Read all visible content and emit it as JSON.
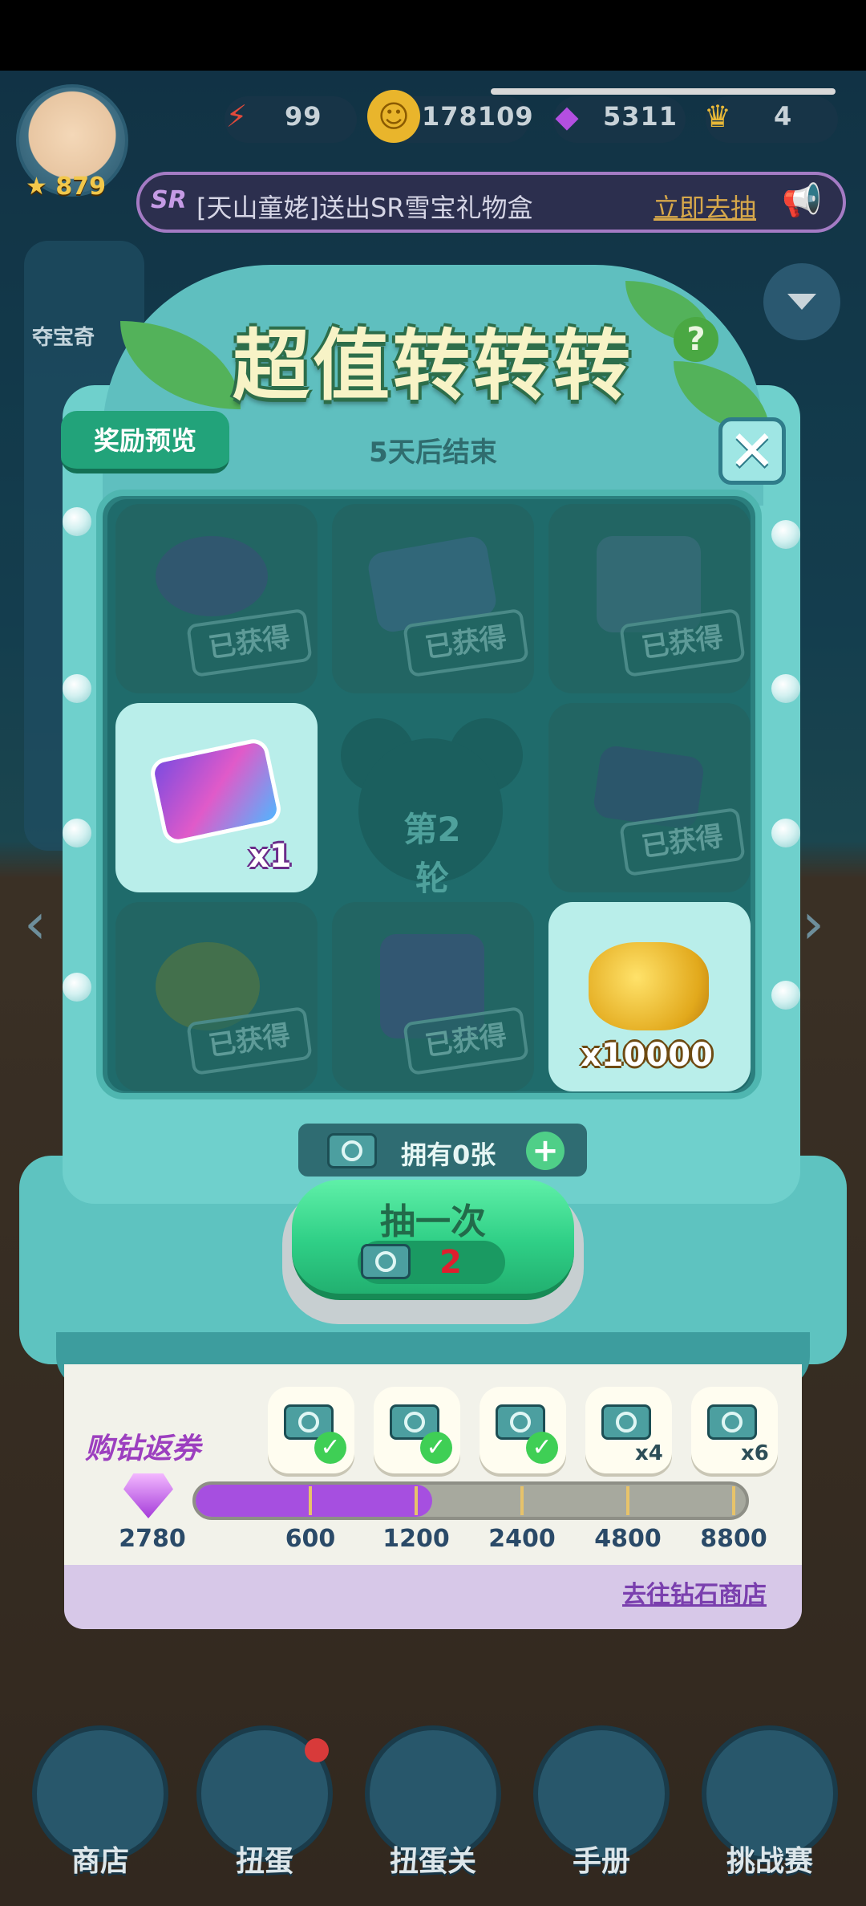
{
  "resources": {
    "level": "879",
    "energy": "99",
    "coins": "178109",
    "diamonds": "5311",
    "crowns": "4"
  },
  "ticker": {
    "tag": "SR",
    "message": "[天山童姥]送出SR雪宝礼物盒",
    "link": "立即去抽"
  },
  "side": {
    "label": "夺宝奇"
  },
  "event": {
    "title": "超值转转转",
    "help": "?",
    "reward_preview": "奖励预览",
    "countdown": "5天后结束",
    "round_label": "第2轮"
  },
  "grid": {
    "obtained_label": "已获得",
    "items": [
      {
        "name": "gem-bundle",
        "state": "obtained"
      },
      {
        "name": "card-ticket",
        "state": "obtained"
      },
      {
        "name": "gift-box",
        "state": "obtained"
      },
      {
        "name": "mickey-card",
        "state": "available",
        "qty": "x1"
      },
      {
        "name": "scan-ticket",
        "state": "obtained"
      },
      {
        "name": "coin-stack",
        "state": "obtained"
      },
      {
        "name": "blue-gift",
        "state": "obtained"
      },
      {
        "name": "gold-coins",
        "state": "available",
        "qty": "x10000"
      }
    ]
  },
  "owned": {
    "text": "拥有0张",
    "plus": "+"
  },
  "draw": {
    "label": "抽一次",
    "cost": "2"
  },
  "track": {
    "title": "购钻返券",
    "current": "2780",
    "progress": 0.43,
    "milestones": [
      {
        "value": "600",
        "claimed": true
      },
      {
        "value": "1200",
        "claimed": true
      },
      {
        "value": "2400",
        "claimed": true
      },
      {
        "value": "4800",
        "claimed": false,
        "qty": "x4"
      },
      {
        "value": "8800",
        "claimed": false,
        "qty": "x6"
      }
    ],
    "shop_link": "去往钻石商店"
  },
  "nav": {
    "shop": "商店",
    "gacha": "扭蛋",
    "gacha_level": "扭蛋关",
    "handbook": "手册",
    "challenge": "挑战赛"
  },
  "colors": {
    "machine": "#6fd0cc",
    "draw_button": "#2fcf86",
    "progress_fill": "#a64fe0",
    "cost_red": "#e01e2e"
  }
}
